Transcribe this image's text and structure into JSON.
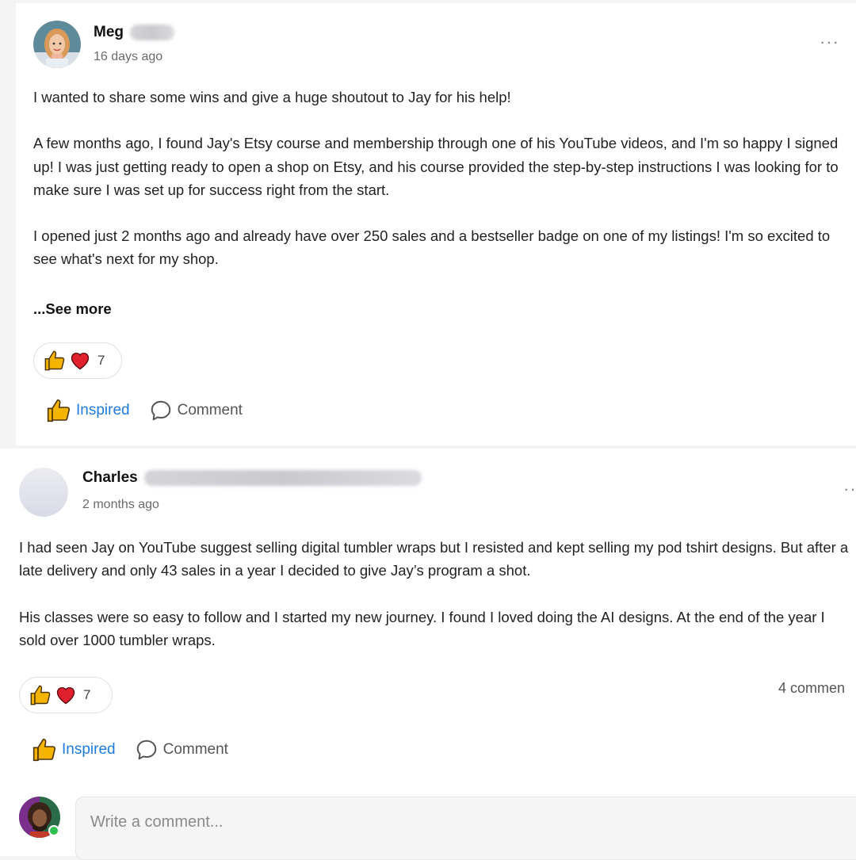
{
  "posts": [
    {
      "author": "Meg",
      "time": "16 days ago",
      "menu": "···",
      "paragraphs": [
        "I wanted to share some wins and give a huge shoutout to Jay for his help!",
        "A few months ago, I found Jay's Etsy course and membership through one of his YouTube videos, and I'm so happy I signed up! I was just getting ready to open a shop on Etsy, and his course provided the step-by-step instructions I was looking for to make sure I was set up for success right from the start.",
        "I opened just 2 months ago and already have over 250 sales and a bestseller badge on one of my listings! I'm so excited to see what's next for my shop."
      ],
      "see_more": "...See more",
      "reaction_count": "7",
      "inspired_label": "Inspired",
      "comment_label": "Comment"
    },
    {
      "author": "Charles",
      "time": "2 months ago",
      "menu": "··",
      "paragraphs": [
        "I had seen Jay on YouTube suggest selling digital tumbler wraps but I resisted and kept selling my pod tshirt designs.  But after a late delivery and only 43 sales in a year I decided to give Jay’s program a shot.",
        "His classes were so easy to follow and I started my new journey.  I found I loved doing the AI designs.  At the end of the year I sold over 1000 tumbler wraps."
      ],
      "reaction_count": "7",
      "comments_count": "4 commen",
      "inspired_label": "Inspired",
      "comment_label": "Comment"
    }
  ],
  "comment_box": {
    "placeholder": "Write a comment..."
  },
  "icons": {
    "thumbs_up": "thumbs-up-icon",
    "heart": "heart-icon",
    "comment": "speech-bubble-icon",
    "more": "more-dots-icon"
  },
  "colors": {
    "accent": "#1f7ae0",
    "heart": "#e0202c",
    "thumb": "#f5b400",
    "online": "#2fbf4f"
  }
}
